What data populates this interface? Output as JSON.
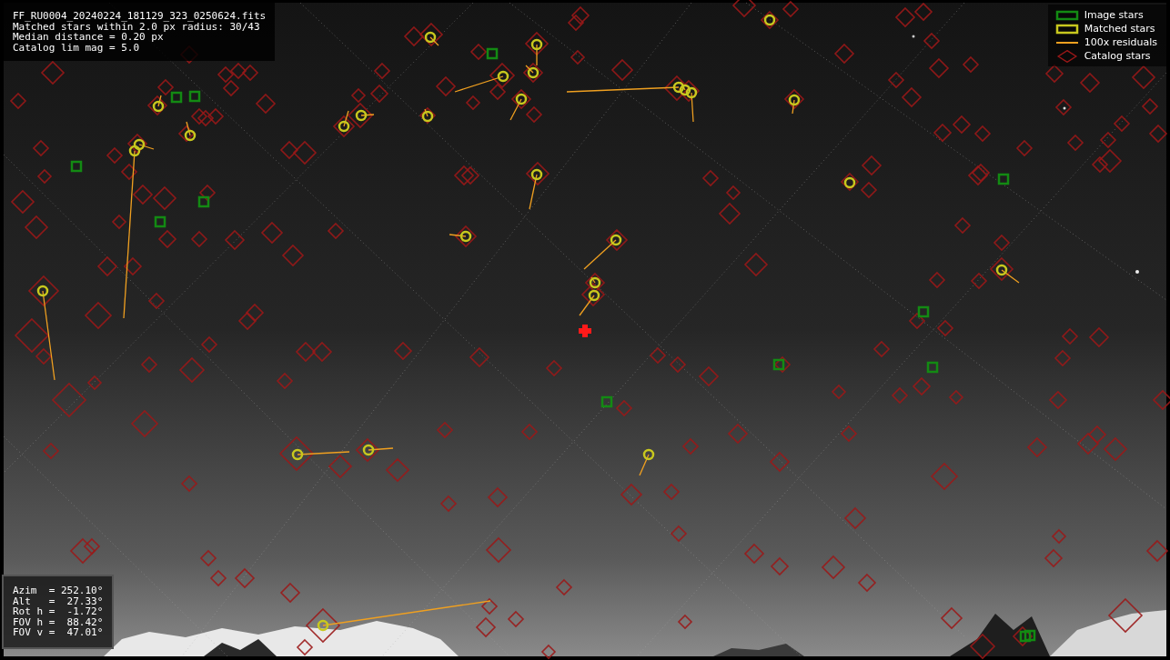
{
  "info_box": {
    "lines": [
      "FF_RU0004_20240224_181129_323_0250624.fits",
      "Matched stars within 2.0 px radius: 30/43",
      "Median distance = 0.20 px",
      "Catalog lim mag = 5.0"
    ]
  },
  "legend": [
    {
      "kind": "box",
      "label": "Image stars",
      "color": "#138a13"
    },
    {
      "kind": "box",
      "label": "Matched stars",
      "color": "#c8c81e"
    },
    {
      "kind": "line",
      "label": "100x residuals",
      "color": "#f0a020"
    },
    {
      "kind": "diamond",
      "label": "Catalog stars",
      "color": "#9a1818"
    }
  ],
  "pointing_box": {
    "lines": [
      "Azim  = 252.10°",
      "Alt   =  27.33°",
      "Rot h =  -1.72°",
      "FOV h =  88.42°",
      "FOV v =  47.01°"
    ]
  }
}
